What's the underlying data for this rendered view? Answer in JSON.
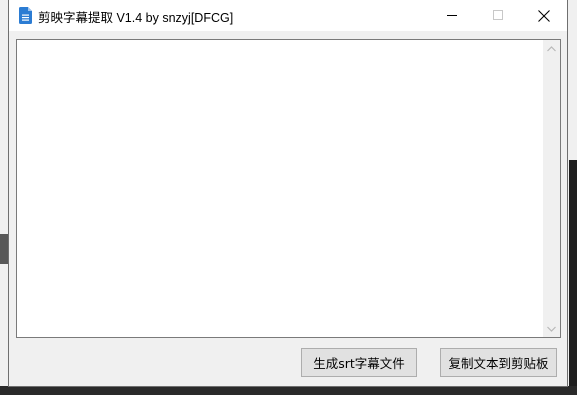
{
  "window": {
    "title": "剪映字幕提取 V1.4 by snzyj[DFCG]",
    "controls": {
      "minimize_icon": "minimize-icon",
      "maximize_icon": "maximize-icon",
      "close_icon": "close-icon"
    }
  },
  "main": {
    "text_content": ""
  },
  "buttons": {
    "generate_srt": "生成srt字幕文件",
    "copy_text": "复制文本到剪贴板"
  },
  "colors": {
    "icon_blue": "#2b7cd3",
    "button_bg": "#e1e1e1",
    "window_bg": "#f0f0f0"
  }
}
